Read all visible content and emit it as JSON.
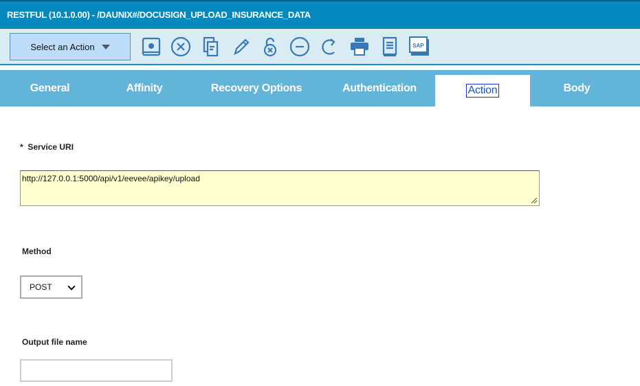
{
  "window": {
    "title": "RESTFUL (10.1.0.00) - /DAUNIX#/DOCUSIGN_UPLOAD_INSURANCE_DATA"
  },
  "toolbar": {
    "action_label": "Select an Action",
    "icons": [
      "save-disk-icon",
      "cancel-circle-x-icon",
      "copy-documents-icon",
      "edit-pencil-icon",
      "unlock-x-icon",
      "remove-minus-icon",
      "redo-icon",
      "print-icon",
      "document-list-icon",
      "sap-icon"
    ],
    "sap_text": "SAP"
  },
  "tabs": [
    {
      "label": "General"
    },
    {
      "label": "Affinity"
    },
    {
      "label": "Recovery Options"
    },
    {
      "label": "Authentication"
    },
    {
      "label": "Action",
      "active": true
    },
    {
      "label": "Body"
    }
  ],
  "form": {
    "service_uri": {
      "required_mark": "*",
      "label": "Service URI",
      "value": "http://127.0.0.1:5000/api/v1/eevee/apikey/upload"
    },
    "method": {
      "label": "Method",
      "value": "POST"
    },
    "output_file": {
      "label": "Output file name",
      "value": ""
    }
  },
  "colors": {
    "titlebar": "#0489bf",
    "toolbar": "#d9ecf4",
    "tabs": "#62b5d8",
    "icon": "#3a78b5",
    "uri_bg": "#ffffcf"
  }
}
